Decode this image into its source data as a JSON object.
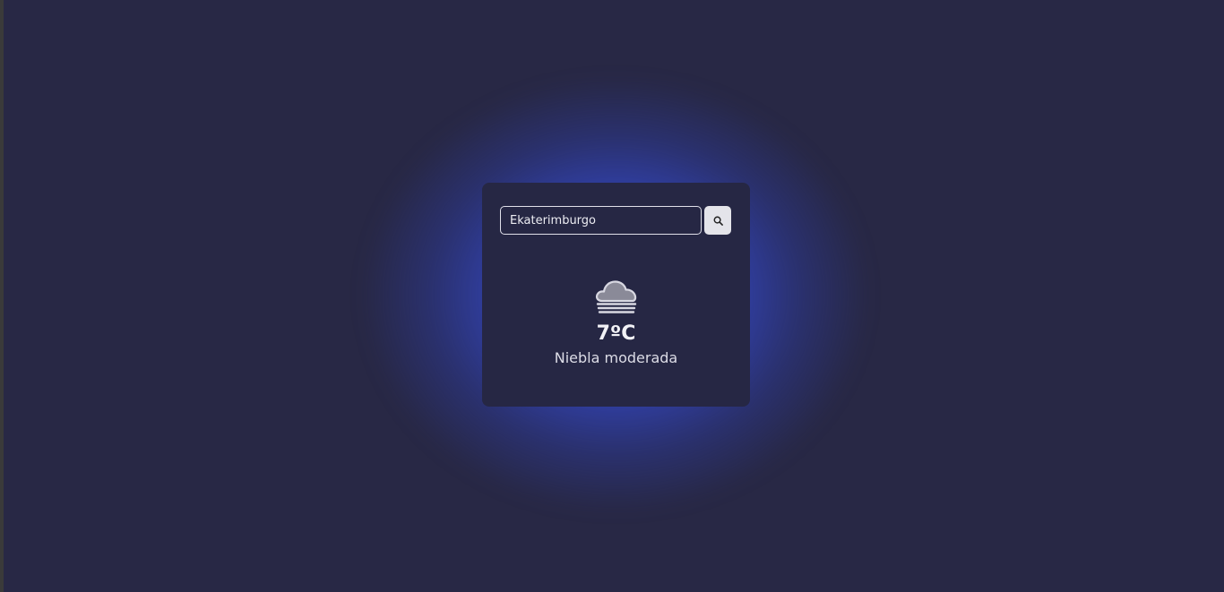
{
  "search": {
    "value": "Ekaterimburgo",
    "button_icon": "search-icon"
  },
  "weather": {
    "icon": "fog-cloud-icon",
    "temperature": "7ºC",
    "description": "Niebla moderada"
  },
  "colors": {
    "background": "#282845",
    "card": "#262744",
    "glow": "#3a52d2",
    "button": "#e4e4ea"
  }
}
